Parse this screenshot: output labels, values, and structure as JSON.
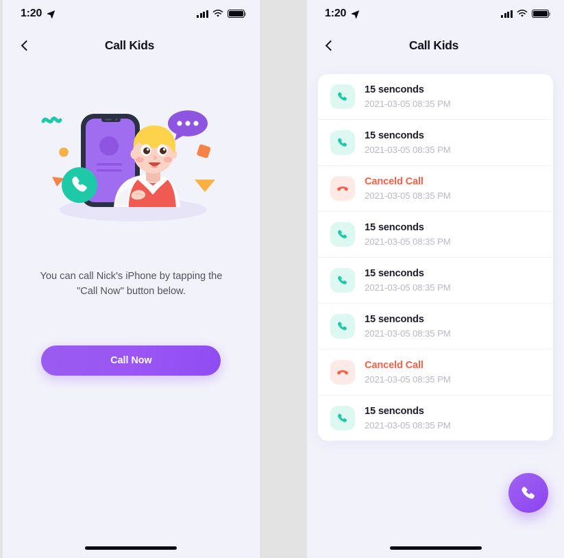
{
  "theme": {
    "screen_bg": "#f2f2fb",
    "gutter_bg": "#e3e3e3",
    "card_bg": "#ffffff",
    "accent_purple": "#9b55f5",
    "accent_green": "#1ec9a8",
    "accent_red": "#f4624a",
    "text_primary": "#13131f",
    "text_muted": "#b8b8c4"
  },
  "status_bar": {
    "time": "1:20",
    "location_icon": "location-arrow-icon",
    "cellular_icon": "signal-bars-icon",
    "wifi_icon": "wifi-icon",
    "battery_icon": "battery-full-icon"
  },
  "nav": {
    "back_icon": "chevron-left-icon",
    "title": "Call Kids",
    "menu_icon": "hamburger-menu-icon"
  },
  "left_screen": {
    "illustration_name": "boy-with-phone-illustration",
    "help_text": "You can call Nick's iPhone by tapping the \"Call Now\" button below.",
    "cta_label": "Call Now"
  },
  "right_screen": {
    "fab_icon": "phone-call-icon",
    "calls": [
      {
        "title": "15 senconds",
        "timestamp": "2021-03-05 08:35 PM",
        "status": "answered",
        "icon": "phone-handset-icon"
      },
      {
        "title": "15 senconds",
        "timestamp": "2021-03-05 08:35 PM",
        "status": "answered",
        "icon": "phone-handset-icon"
      },
      {
        "title": "Canceld Call",
        "timestamp": "2021-03-05 08:35 PM",
        "status": "canceled",
        "icon": "phone-hangup-icon"
      },
      {
        "title": "15 senconds",
        "timestamp": "2021-03-05 08:35 PM",
        "status": "answered",
        "icon": "phone-handset-icon"
      },
      {
        "title": "15 senconds",
        "timestamp": "2021-03-05 08:35 PM",
        "status": "answered",
        "icon": "phone-handset-icon"
      },
      {
        "title": "15 senconds",
        "timestamp": "2021-03-05 08:35 PM",
        "status": "answered",
        "icon": "phone-handset-icon"
      },
      {
        "title": "Canceld Call",
        "timestamp": "2021-03-05 08:35 PM",
        "status": "canceled",
        "icon": "phone-hangup-icon"
      },
      {
        "title": "15 senconds",
        "timestamp": "2021-03-05 08:35 PM",
        "status": "answered",
        "icon": "phone-handset-icon"
      }
    ]
  }
}
